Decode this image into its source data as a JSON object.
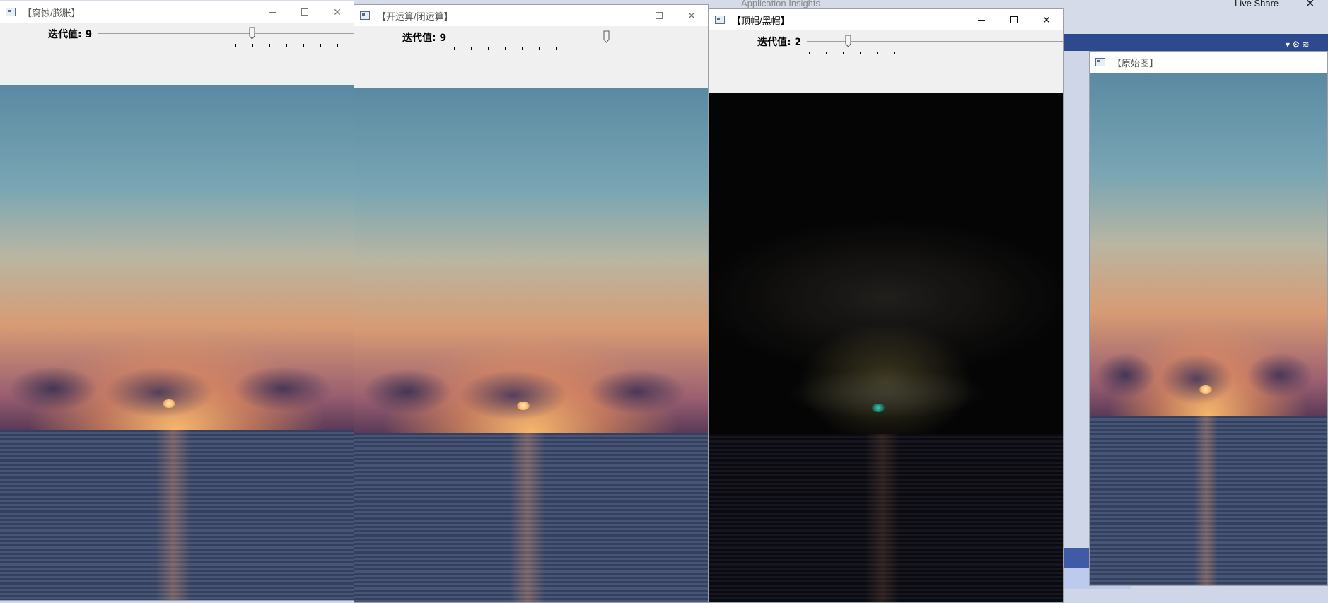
{
  "background_app": {
    "live_share_label": "Live Share",
    "application_insights_label": "Application Insights",
    "close_glyph": "✕",
    "band_icons": "▾ ⚙ ≋"
  },
  "windows": {
    "erode_dilate": {
      "title": "【腐蚀/膨胀】",
      "trackbar_label": "迭代值: 9",
      "trackbar_value": 9
    },
    "open_close": {
      "title": "【开运算/闭运算】",
      "trackbar_label": "迭代值: 9",
      "trackbar_value": 9
    },
    "tophat_blackhat": {
      "title": "【顶帽/黑帽】",
      "trackbar_label": "迭代值: 2",
      "trackbar_value": 2
    },
    "original": {
      "title": "【原始图】"
    }
  },
  "caption_buttons": {
    "close_glyph": "✕"
  },
  "colors": {
    "accent_band": "#2e4a8e",
    "window_bg": "#f0f0f0",
    "titlebar_bg": "#ffffff"
  }
}
